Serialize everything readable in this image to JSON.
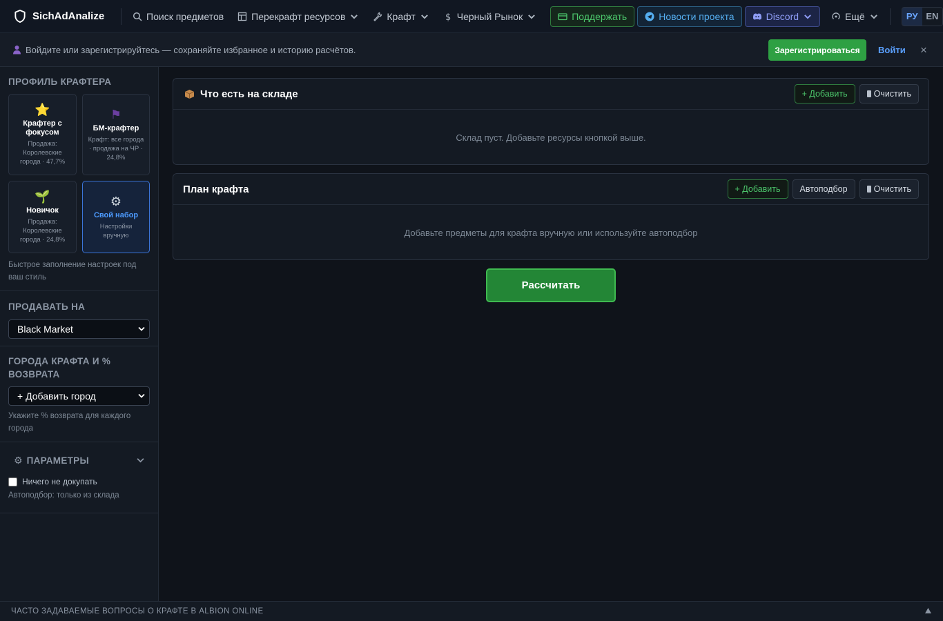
{
  "nav": {
    "brand": "SichAdAnalize",
    "search_items": "Поиск предметов",
    "recraft": "Перекрафт ресурсов",
    "craft": "Крафт",
    "black_market": "Черный Рынок",
    "support": "Поддержать",
    "news": "Новости проекта",
    "discord": "Discord",
    "more": "Ещё",
    "lang_ru": "РУ",
    "lang_en": "EN"
  },
  "banner": {
    "text": "Войдите или зарегистрируйтесь — сохраняйте избранное и историю расчётов.",
    "register": "Зарегистрироваться",
    "login": "Войти",
    "close": "×"
  },
  "sidebar": {
    "profile_title": "ПРОФИЛЬ КРАФТЕРА",
    "profiles": [
      {
        "icon": "⭐",
        "title": "Крафтер с фокусом",
        "desc": "Продажа: Королевские города · 47,7%"
      },
      {
        "icon": "⚑",
        "title": "БМ-крафтер",
        "desc": "Крафт: все города · продажа на ЧР · 24,8%"
      },
      {
        "icon": "🌱",
        "title": "Новичок",
        "desc": "Продажа: Королевские города · 24,8%"
      },
      {
        "icon": "⚙",
        "title": "Свой набор",
        "desc": "Настройки вручную"
      }
    ],
    "profile_hint": "Быстрое заполнение настроек под ваш стиль",
    "sell_title": "ПРОДАВАТЬ НА",
    "sell_value": "Black Market",
    "cities_title": "ГОРОДА КРАФТА И % ВОЗВРАТА",
    "cities_value": "+ Добавить город",
    "cities_hint": "Укажите % возврата для каждого города",
    "params_title": "ПАРАМЕТРЫ",
    "no_buy_label": "Ничего не докупать",
    "autopick_hint": "Автоподбор: только из склада"
  },
  "main": {
    "stock_title": "Что есть на складе",
    "stock_add": "+ Добавить",
    "stock_clear": "Очистить",
    "stock_empty": "Склад пуст. Добавьте ресурсы кнопкой выше.",
    "plan_title": "План крафта",
    "plan_add": "+ Добавить",
    "plan_auto": "Автоподбор",
    "plan_clear": "Очистить",
    "plan_empty": "Добавьте предметы для крафта вручную или используйте автоподбор",
    "calculate": "Рассчитать"
  },
  "footer": {
    "faq": "ЧАСТО ЗАДАВАЕМЫЕ ВОПРОСЫ О КРАФТЕ В ALBION ONLINE"
  },
  "colors": {
    "accent_green": "#2ea043",
    "accent_blue": "#3b74d8",
    "background": "#0f131a"
  }
}
